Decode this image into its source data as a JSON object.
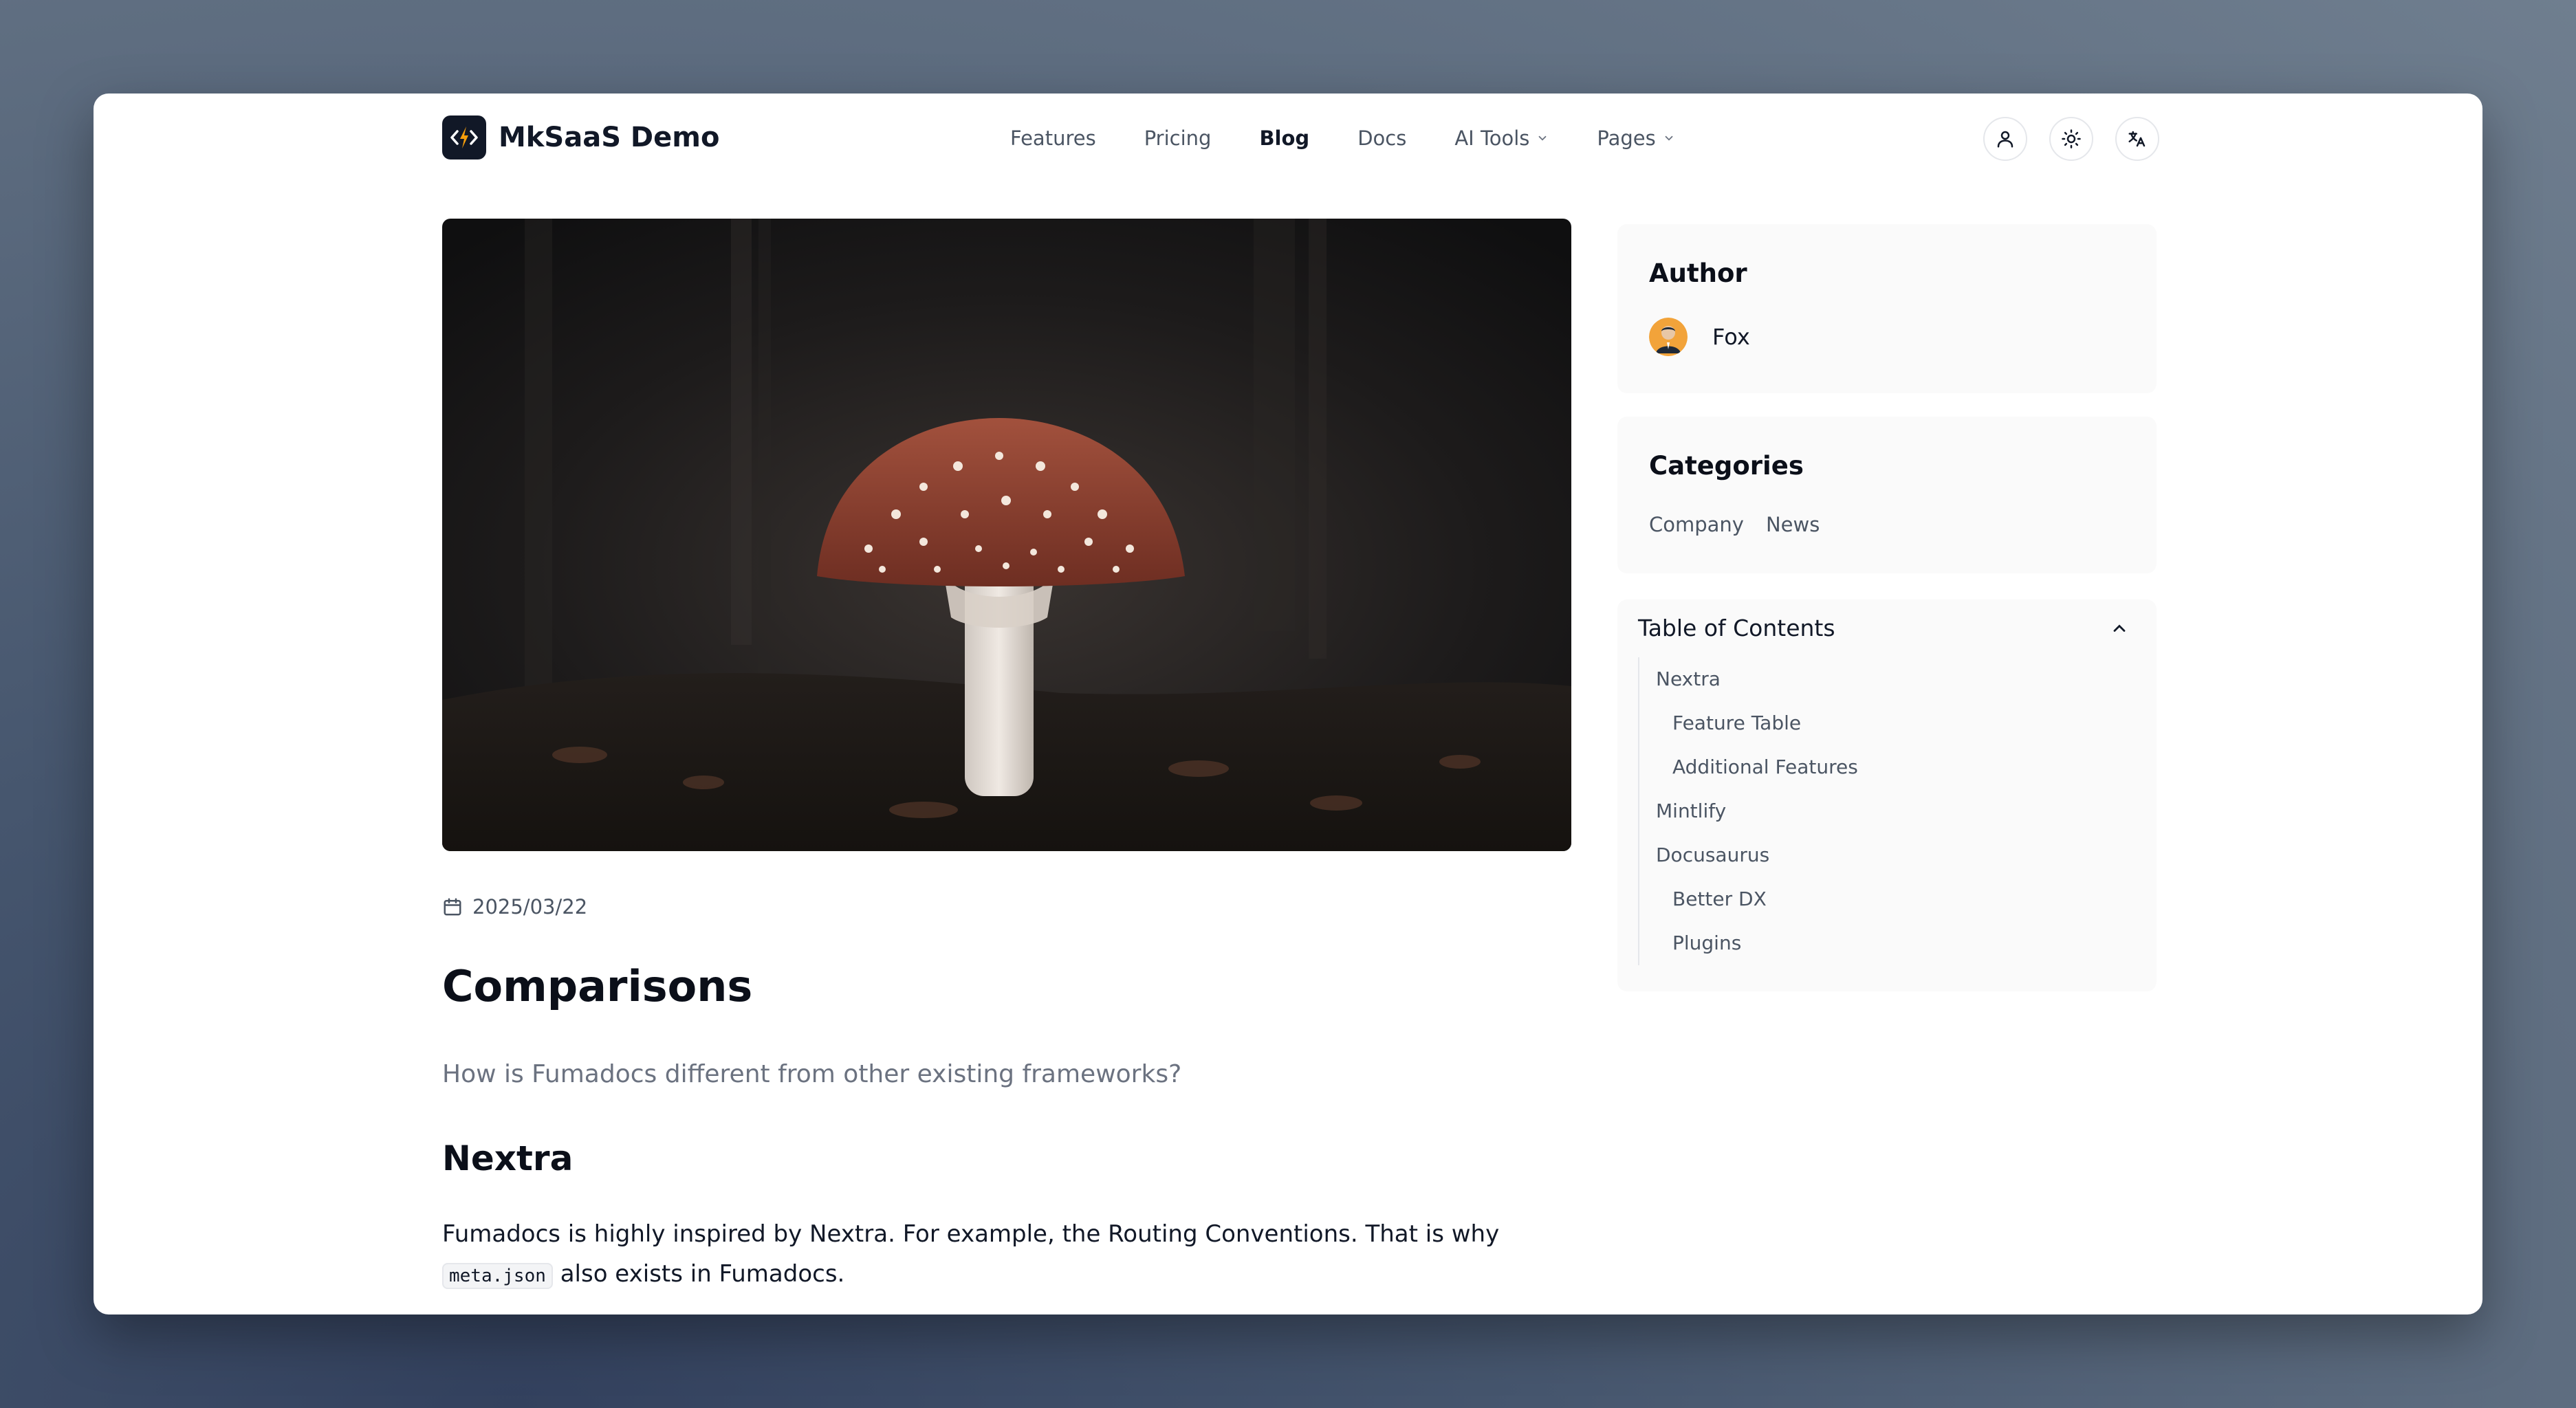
{
  "brand": {
    "name": "MkSaaS Demo",
    "logo_icon": "code-bolt-icon"
  },
  "nav": {
    "items": [
      {
        "label": "Features",
        "active": false,
        "dropdown": false
      },
      {
        "label": "Pricing",
        "active": false,
        "dropdown": false
      },
      {
        "label": "Blog",
        "active": true,
        "dropdown": false
      },
      {
        "label": "Docs",
        "active": false,
        "dropdown": false
      },
      {
        "label": "AI Tools",
        "active": false,
        "dropdown": true
      },
      {
        "label": "Pages",
        "active": false,
        "dropdown": true
      }
    ],
    "actions": [
      "user-icon",
      "sun-icon",
      "translate-icon"
    ]
  },
  "article": {
    "date": "2025/03/22",
    "title": "Comparisons",
    "description": "How is Fumadocs different from other existing frameworks?",
    "section_title": "Nextra",
    "paragraph_before_code": "Fumadocs is highly inspired by Nextra. For example, the Routing Conventions. That is why ",
    "code": "meta.json",
    "paragraph_after_code": " also exists in Fumadocs."
  },
  "sidebar": {
    "author": {
      "heading": "Author",
      "name": "Fox"
    },
    "categories": {
      "heading": "Categories",
      "items": [
        "Company",
        "News"
      ]
    },
    "toc": {
      "heading": "Table of Contents",
      "items": [
        {
          "label": "Nextra",
          "level": 1
        },
        {
          "label": "Feature Table",
          "level": 2
        },
        {
          "label": "Additional Features",
          "level": 2
        },
        {
          "label": "Mintlify",
          "level": 1
        },
        {
          "label": "Docusaurus",
          "level": 1
        },
        {
          "label": "Better DX",
          "level": 2
        },
        {
          "label": "Plugins",
          "level": 2
        }
      ]
    }
  }
}
